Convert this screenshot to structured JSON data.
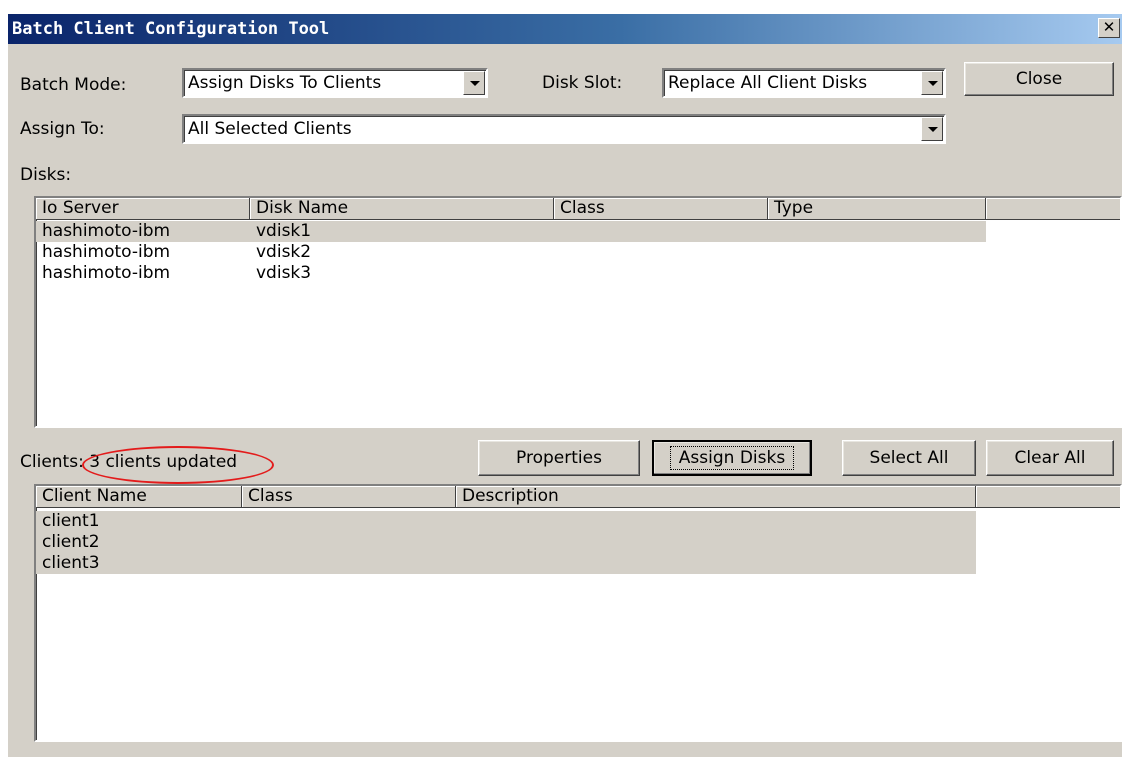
{
  "window": {
    "title": "Batch Client Configuration Tool",
    "close_glyph": "✕"
  },
  "batch_mode": {
    "label": "Batch Mode:",
    "value": "Assign Disks To Clients"
  },
  "disk_slot": {
    "label": "Disk Slot:",
    "value": "Replace All Client Disks"
  },
  "close_button": "Close",
  "assign_to": {
    "label": "Assign To:",
    "value": "All Selected Clients"
  },
  "disks": {
    "label": "Disks:",
    "columns": [
      "Io Server",
      "Disk Name",
      "Class",
      "Type"
    ],
    "rows": [
      {
        "io_server": "hashimoto-ibm",
        "disk_name": "vdisk1",
        "class": "",
        "type": "",
        "selected": true
      },
      {
        "io_server": "hashimoto-ibm",
        "disk_name": "vdisk2",
        "class": "",
        "type": "",
        "selected": false
      },
      {
        "io_server": "hashimoto-ibm",
        "disk_name": "vdisk3",
        "class": "",
        "type": "",
        "selected": false
      }
    ]
  },
  "clients": {
    "label": "Clients:",
    "status": "3 clients updated",
    "highlight_color": "#e31b1b",
    "columns": [
      "Client Name",
      "Class",
      "Description"
    ],
    "rows": [
      {
        "client_name": "client1",
        "class": "",
        "description": "",
        "selected": true
      },
      {
        "client_name": "client2",
        "class": "",
        "description": "",
        "selected": true
      },
      {
        "client_name": "client3",
        "class": "",
        "description": "",
        "selected": true
      }
    ]
  },
  "buttons": {
    "properties": "Properties",
    "assign_disks": "Assign Disks",
    "select_all": "Select All",
    "clear_all": "Clear All"
  }
}
